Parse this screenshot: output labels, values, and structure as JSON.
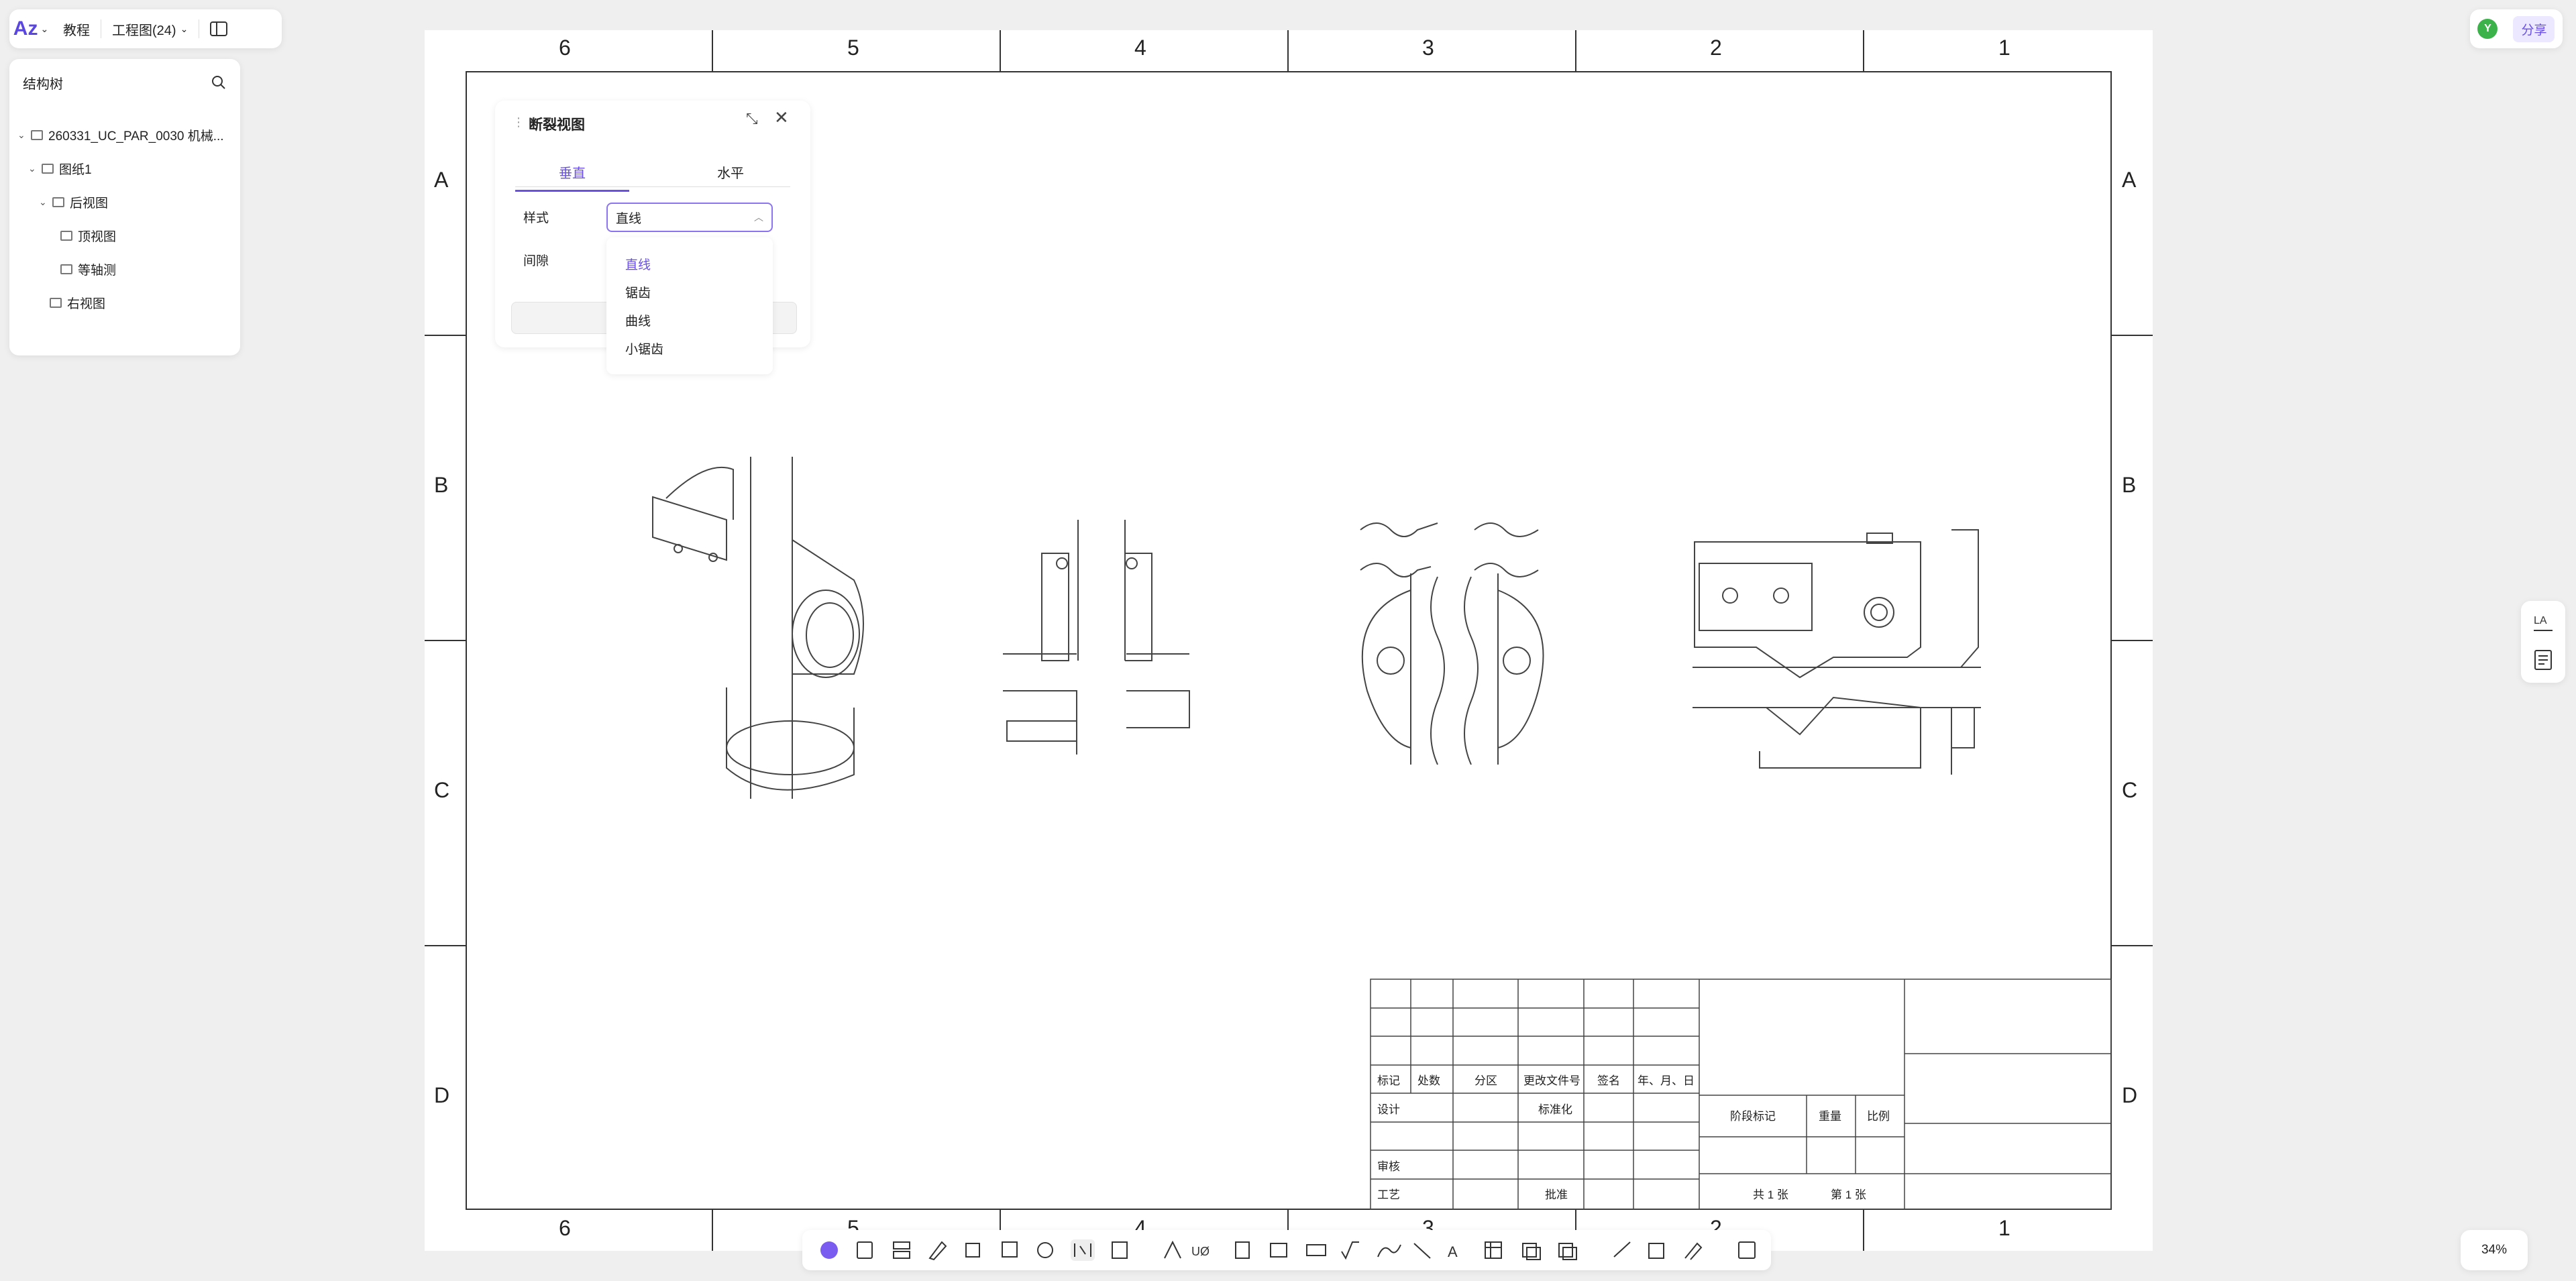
{
  "topbar": {
    "logo": "Az",
    "tutorial": "教程",
    "doc_name": "工程图(24)"
  },
  "tree": {
    "title": "结构树",
    "items": [
      {
        "label": "260331_UC_PAR_0030 机械..."
      },
      {
        "label": "图纸1"
      },
      {
        "label": "后视图"
      },
      {
        "label": "顶视图"
      },
      {
        "label": "等轴测"
      },
      {
        "label": "右视图"
      }
    ]
  },
  "dialog": {
    "title": "断裂视图",
    "tabs": [
      {
        "label": "垂直"
      },
      {
        "label": "水平"
      }
    ],
    "style_label": "样式",
    "gap_label": "间隙",
    "style_value": "直线",
    "options": [
      {
        "label": "直线"
      },
      {
        "label": "锯齿"
      },
      {
        "label": "曲线"
      },
      {
        "label": "小锯齿"
      }
    ]
  },
  "share": {
    "avatar": "Y",
    "label": "分享"
  },
  "zoom": "34%",
  "sheet": {
    "cols_top": [
      "6",
      "5",
      "4",
      "3",
      "2",
      "1"
    ],
    "rows": [
      "A",
      "B",
      "C",
      "D"
    ]
  },
  "title_block": {
    "hdr_mark": "标记",
    "hdr_count": "处数",
    "hdr_zone": "分区",
    "hdr_doc": "更改文件号",
    "hdr_sign": "签名",
    "hdr_date": "年、月、日",
    "design": "设计",
    "std": "标准化",
    "review": "审核",
    "craft": "工艺",
    "approve": "批准",
    "stage": "阶段标记",
    "weight": "重量",
    "scale": "比例",
    "total": "共 1 张",
    "sheet_no": "第 1 张"
  },
  "colors": {
    "accent": "#6a50e8",
    "sheet": "#ffffff",
    "bg": "#efefef"
  }
}
